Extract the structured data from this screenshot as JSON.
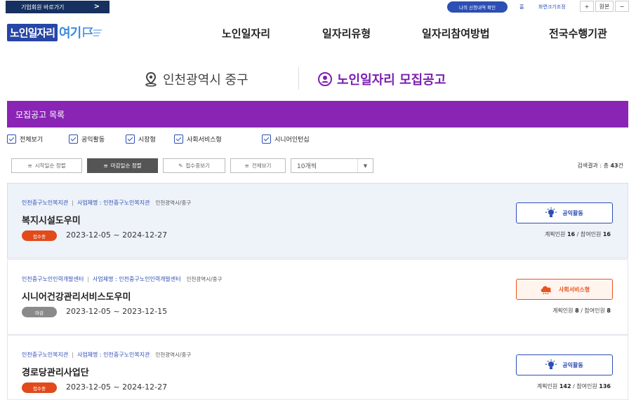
{
  "utility": {
    "corp_link": "기업회원 바로가기",
    "apply_history": "나의 신청내역 확인",
    "home": "홈",
    "zoom_label": "화면크기조정",
    "zoom_in": "+",
    "zoom_reset": "원본",
    "zoom_out": "−"
  },
  "header": {
    "logo_text_a": "노인일자리",
    "logo_text_b": "여기",
    "nav": [
      "노인일자리",
      "일자리유형",
      "일자리참여방법",
      "전국수행기관"
    ]
  },
  "title_row": {
    "region": "인천광역시 중구",
    "page_title": "노인일자리 모집공고"
  },
  "list": {
    "header": "모집공고 목록",
    "filters": [
      "전체보기",
      "공익활동",
      "시장형",
      "사회서비스형",
      "시니어인턴십"
    ],
    "sort_buttons": [
      "시작일순 정렬",
      "마감일순 정렬",
      "접수중보기",
      "전체보기"
    ],
    "page_size": "10개씩",
    "result_prefix": "검색결과 : 총",
    "result_count": "43",
    "result_suffix": "건"
  },
  "colors": {
    "brand_purple": "#8a24b5",
    "title_purple": "#7b1fb0",
    "brand_blue": "#2d4eb4",
    "status_open": "#e24a1c",
    "status_closed": "#8a8a8a",
    "public_badge": "#2d4eb4",
    "social_badge": "#e8541c"
  },
  "postings": [
    {
      "org": "인천중구노인복지관",
      "biz_prefix": "사업체명 :",
      "biz_name": "인천중구노인복지관",
      "location": "인천광역시/중구",
      "title": "복지시설도우미",
      "status": "접수중",
      "dates": "2023-12-05 ~ 2024-12-27",
      "type": "공익활동",
      "plan_label": "계획인원",
      "plan": "16",
      "part_label": "/ 참여인원",
      "participants": "16"
    },
    {
      "org": "인천중구노인인력개발센터",
      "biz_prefix": "사업체명 :",
      "biz_name": "인천중구노인인력개발센터",
      "location": "인천광역시/중구",
      "title": "시니어건강관리서비스도우미",
      "status": "마감",
      "dates": "2023-12-05 ~ 2023-12-15",
      "type": "사회서비스형",
      "plan_label": "계획인원",
      "plan": "8",
      "part_label": "/ 참여인원",
      "participants": "8"
    },
    {
      "org": "인천중구노인복지관",
      "biz_prefix": "사업체명 :",
      "biz_name": "인천중구노인복지관",
      "location": "인천광역시/중구",
      "title": "경로당관리사업단",
      "status": "접수중",
      "dates": "2023-12-05 ~ 2024-12-27",
      "type": "공익활동",
      "plan_label": "계획인원",
      "plan": "142",
      "part_label": "/ 참여인원",
      "participants": "136"
    }
  ]
}
